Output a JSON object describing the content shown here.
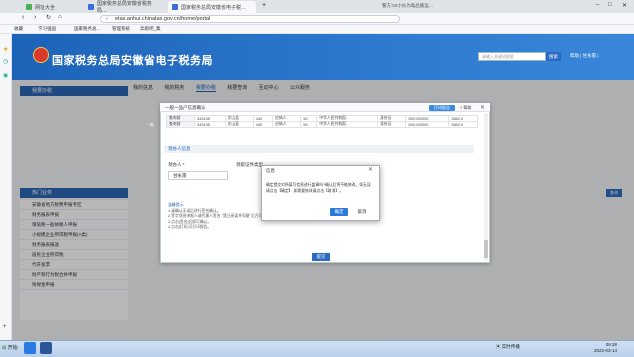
{
  "browser": {
    "tabs": [
      {
        "label": "网址大全",
        "active": false
      },
      {
        "label": "国家税务总局安徽省税务局…",
        "active": false
      },
      {
        "label": "国家税务总局安徽省电子税…",
        "active": true
      }
    ],
    "url": "etax.anhui.chinatax.gov.cn/home/portal",
    "bookmarks": [
      "收藏",
      "学习强国",
      "国家税务总…",
      "管理系统",
      "奔跑吧_集"
    ],
    "search_hint": "警方:50小伙为毒品搬运…"
  },
  "site": {
    "title": "国家税务总局安徽省电子税务局",
    "search_placeholder": "请输入关键词搜索",
    "search_button": "搜索",
    "user_links": "帮助 | 甘永雷 |",
    "nav_tabs": [
      "我的信息",
      "我的税务",
      "我要办税",
      "我要查询",
      "互动中心",
      "公众服务"
    ],
    "sidebar_head_1": "我要办税",
    "sidebar_head_2": "热门业务",
    "sidebar_items": [
      "安徽省地方税费申报专区",
      "财务报表申报",
      "增值税一般纳税人申报",
      "小规模企业所得税申报(A类)",
      "财务报表报送",
      "居民企业所得税",
      "代开发票",
      "财产和行为税合并申报",
      "残保金申报"
    ],
    "blue_button": "查询"
  },
  "modal": {
    "title": "一般一品户信息确认",
    "print_button": "打印报告",
    "help_link": "帮助",
    "row_prefix": "一般",
    "rows": [
      [
        "查询部",
        "343435",
        "文山县",
        "440",
        "应纳人",
        "50",
        "中华人民共和国…",
        "身份证",
        "255.000000",
        "2650.0"
      ],
      [
        "查询部",
        "343435",
        "文山县",
        "440",
        "应纳人",
        "50",
        "中华人民共和国…",
        "身份证",
        "255.000000",
        "2650.0"
      ]
    ],
    "section_title": "领办人信息",
    "agent_label": "领办人 *",
    "agent_value": "甘永雷",
    "cert_label": "领取证件类型",
    "tips": [
      "温馨提示:",
      "1.请确认无误后进行签名确认。",
      "2.签字须由申报人或代理人签名,\"我已阅读并同意\"后方可提交。",
      "3.点击[签名]后即可确认。",
      "4.点击[打印]可打印报告。"
    ],
    "submit_button": "提交"
  },
  "confirm": {
    "title": "信息",
    "message": "确定提交对所填写信息进行盖章吗?确认后将不能修改。如无误请点击【确定】,如需要修改请点击【取消】。",
    "ok": "确定",
    "cancel": "取消"
  },
  "taskbar": {
    "start": "开始",
    "tray_text": "实时传播",
    "time": "09:38",
    "date": "2022-03-14"
  },
  "colors": {
    "header_blue": "#1c63b8",
    "button_blue": "#2b79d8"
  }
}
